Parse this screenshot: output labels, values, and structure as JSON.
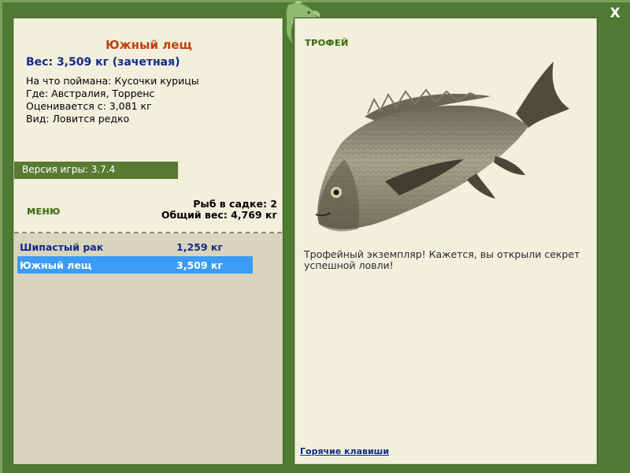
{
  "fish": {
    "title": "Южный лещ",
    "weight": "Вес: 3,509 кг (зачетная)",
    "details": [
      "На что поймана: Кусочки курицы",
      "Где: Австралия, Торренс",
      "Оценивается с: 3,081 кг",
      "Вид: Ловится редко"
    ]
  },
  "version": "Версия игры: 3.7.4",
  "menu_label": "МЕНЮ",
  "summary": {
    "count": "Рыб в садке: 2",
    "total_weight": "Общий вес: 4,769 кг"
  },
  "catch_list": [
    {
      "name": "Шипастый рак",
      "weight": "1,259 кг",
      "selected": false
    },
    {
      "name": "Южный лещ",
      "weight": "3,509 кг",
      "selected": true
    }
  ],
  "trophy": {
    "label": "ТРОФЕЙ",
    "text": "Трофейный экземпляр! Кажется, вы открыли секрет успешной ловли!"
  },
  "hotkeys_label": "Горячие клавиши",
  "close_label": "X",
  "icons": {
    "emblem": "fish-emblem-icon",
    "close": "close-icon"
  },
  "colors": {
    "frame": "#4f7a33",
    "panel": "#f2efdd",
    "selected": "#3c9cf5",
    "title": "#c0420e",
    "accent_text": "#142a86"
  }
}
